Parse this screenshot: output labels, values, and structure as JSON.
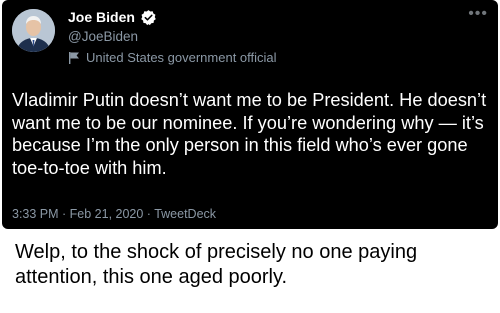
{
  "tweet": {
    "display_name": "Joe Biden",
    "handle": "@JoeBiden",
    "label": "United States government official",
    "text": "Vladimir Putin doesn’t want me to be President. He doesn’t want me to be our nominee. If you’re wondering why — it’s because I’m the only person in this field who’s ever gone toe-to-toe with him.",
    "meta": "3:33 PM · Feb 21, 2020 · TweetDeck",
    "more_icon": "more-horizontal-icon",
    "verified_icon": "verified-badge-icon",
    "label_icon": "flag-icon",
    "colors": {
      "card_bg": "#000000",
      "text": "#ffffff",
      "secondary": "#8b98a5"
    }
  },
  "caption": {
    "text": "Welp, to the shock of precisely no one paying attention, this one aged poorly."
  }
}
